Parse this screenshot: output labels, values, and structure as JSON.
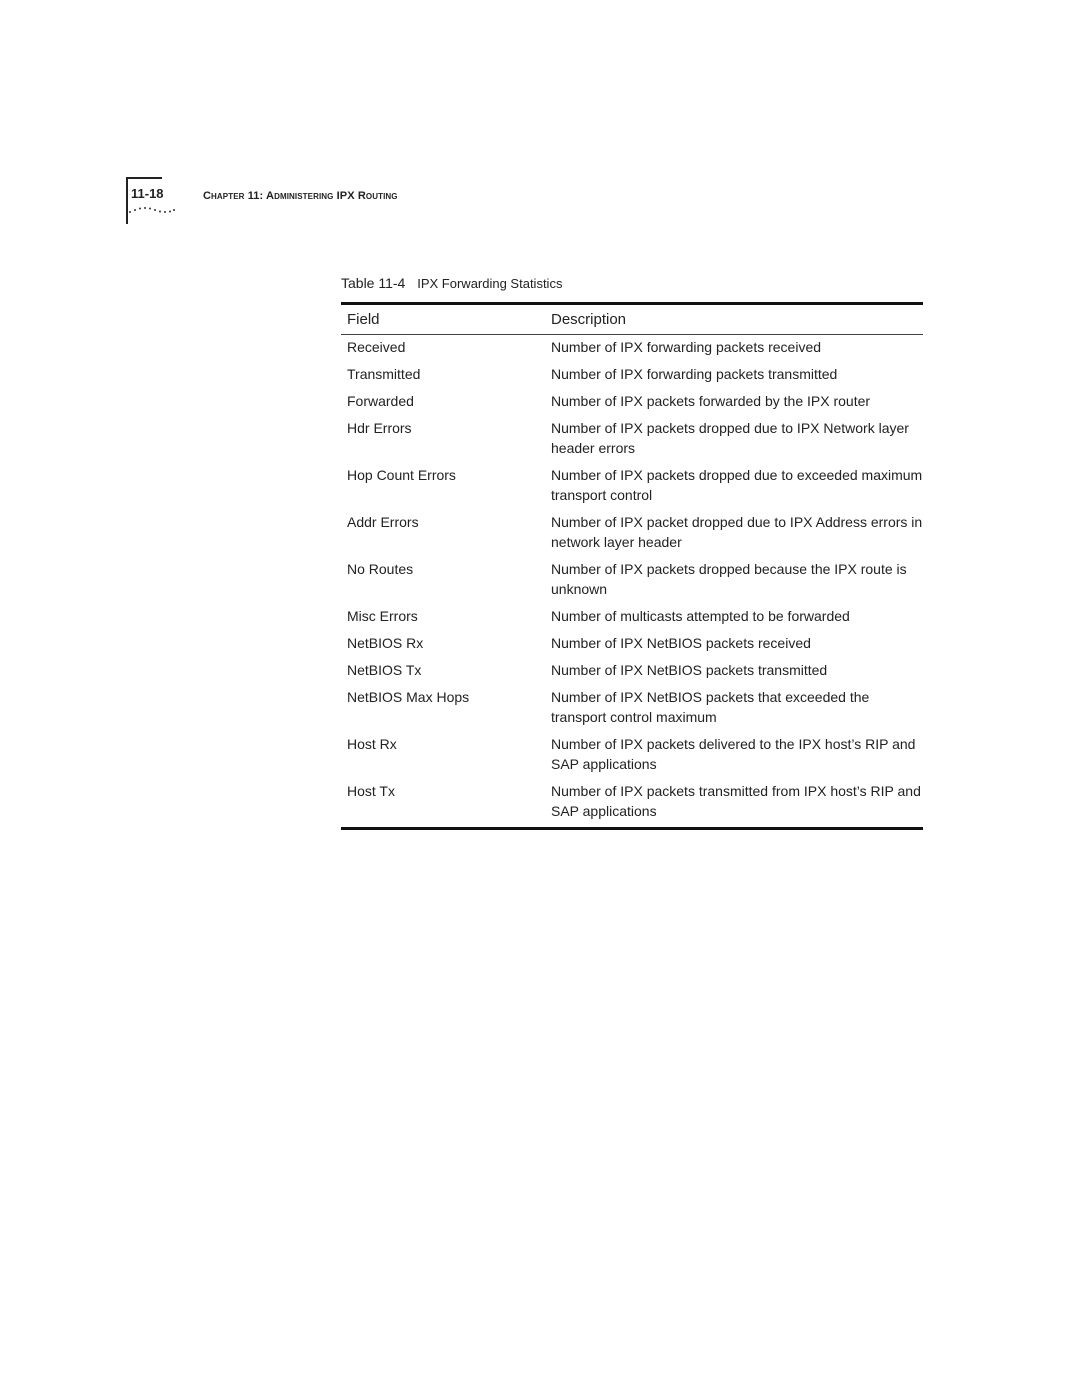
{
  "header": {
    "page_number": "11-18",
    "chapter_prefix": "Chapter 11: ",
    "chapter_title": "Administering IPX Routing"
  },
  "table": {
    "caption_number": "Table 11-4",
    "caption_title": "IPX Forwarding Statistics",
    "columns": [
      "Field",
      "Description"
    ],
    "rows": [
      {
        "field": "Received",
        "description": "Number of IPX forwarding packets received"
      },
      {
        "field": "Transmitted",
        "description": "Number of IPX forwarding packets transmitted"
      },
      {
        "field": "Forwarded",
        "description": "Number of IPX packets forwarded by the IPX router"
      },
      {
        "field": "Hdr Errors",
        "description": "Number of IPX packets dropped due to IPX Network layer header errors"
      },
      {
        "field": "Hop Count Errors",
        "description": "Number of IPX packets dropped due to exceeded maximum transport control"
      },
      {
        "field": "Addr Errors",
        "description": "Number of IPX packet dropped due to IPX Address errors in network layer header"
      },
      {
        "field": "No Routes",
        "description": "Number of IPX packets dropped because the IPX route is unknown"
      },
      {
        "field": "Misc Errors",
        "description": "Number of multicasts attempted to be forwarded"
      },
      {
        "field": "NetBIOS Rx",
        "description": "Number of IPX NetBIOS packets received"
      },
      {
        "field": "NetBIOS Tx",
        "description": "Number of IPX NetBIOS packets transmitted"
      },
      {
        "field": "NetBIOS Max Hops",
        "description": "Number of IPX NetBIOS packets that exceeded the transport control maximum"
      },
      {
        "field": "Host Rx",
        "description": "Number of IPX packets delivered to the IPX host’s RIP and SAP applications"
      },
      {
        "field": "Host Tx",
        "description": "Number of IPX packets transmitted from IPX host’s RIP and SAP applications"
      }
    ]
  }
}
